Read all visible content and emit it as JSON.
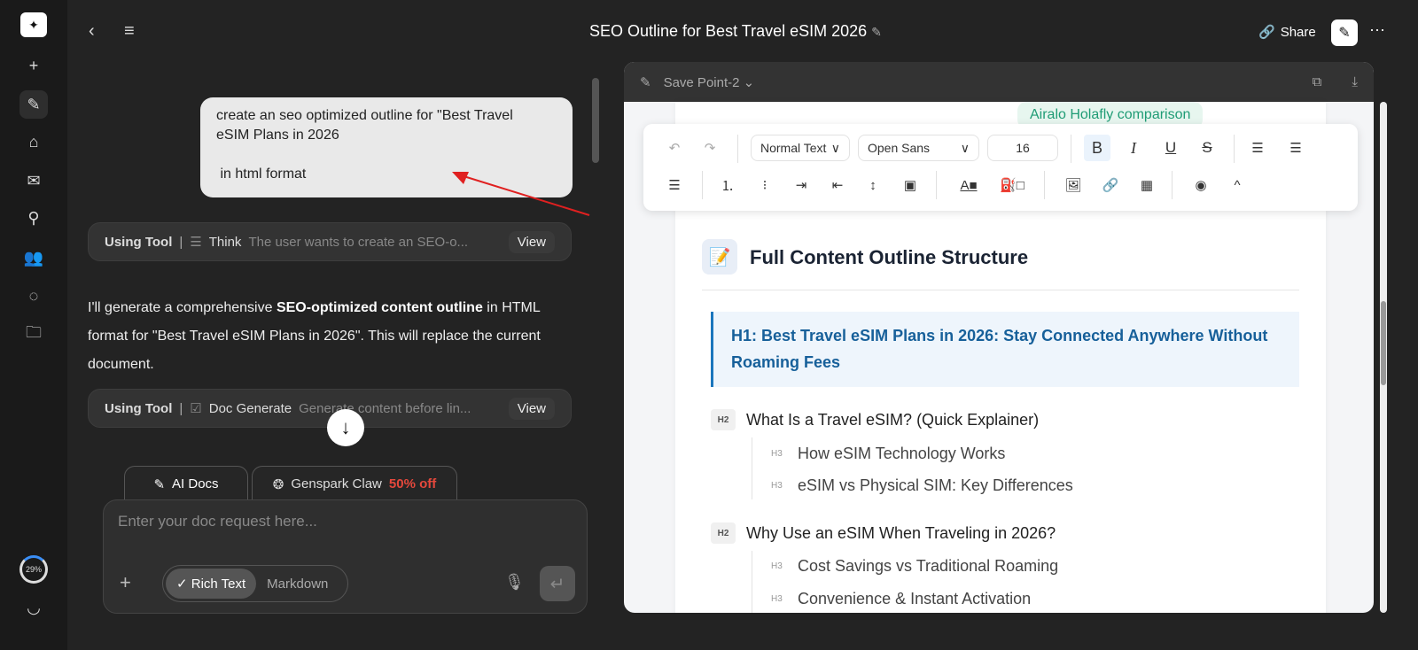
{
  "sidebar": {
    "items": [
      {
        "icon": "plus-icon",
        "glyph": "+"
      },
      {
        "icon": "ai-docs-icon",
        "glyph": "✎"
      },
      {
        "icon": "home-icon",
        "glyph": "⌂"
      },
      {
        "icon": "inbox-sparkle-icon",
        "glyph": "✉"
      },
      {
        "icon": "hierarchy-icon",
        "glyph": "⚲"
      },
      {
        "icon": "users-icon",
        "glyph": "👥"
      },
      {
        "icon": "circle-nodes-icon",
        "glyph": "◌"
      },
      {
        "icon": "folder-icon",
        "glyph": "🗀"
      }
    ],
    "usage": "29%"
  },
  "header": {
    "title": "SEO Outline for Best Travel eSIM 2026",
    "share": "Share"
  },
  "chat": {
    "user_message": "create an seo optimized outline for \"Best Travel\neSIM Plans in 2026\n\n in html format",
    "tools": [
      {
        "label": "Using Tool",
        "sep": "|",
        "name": "Think",
        "desc": "The user wants to create an SEO-o...",
        "view": "View"
      },
      {
        "label": "Using Tool",
        "sep": "|",
        "name": "Doc Generate",
        "desc": "Generate content before lin...",
        "view": "View"
      }
    ],
    "reply": {
      "pre": "I'll generate a comprehensive ",
      "bold": "SEO-optimized content outline",
      "post": " in HTML format for \"Best Travel eSIM Plans in 2026\". This will replace the current document."
    }
  },
  "composer": {
    "tabs": [
      {
        "label": "AI Docs"
      },
      {
        "label": "Genspark Claw",
        "promo": "50% off"
      }
    ],
    "placeholder": "Enter your doc request here...",
    "modes": [
      "Rich Text",
      "Markdown"
    ],
    "accent": "#e5483c"
  },
  "doc": {
    "save_point": "Save Point-2",
    "toolbar": {
      "style": "Normal Text",
      "font": "Open Sans",
      "size": "16"
    },
    "chip": "Airalo Holafly comparison",
    "section_title": "Full Content Outline Structure",
    "h1": "H1: Best Travel eSIM Plans in 2026: Stay Connected Anywhere Without Roaming Fees",
    "outline": [
      {
        "level": "H2",
        "text": "What Is a Travel eSIM? (Quick Explainer)",
        "children": [
          {
            "level": "H3",
            "text": "How eSIM Technology Works"
          },
          {
            "level": "H3",
            "text": "eSIM vs Physical SIM: Key Differences"
          }
        ]
      },
      {
        "level": "H2",
        "text": "Why Use an eSIM When Traveling in 2026?",
        "children": [
          {
            "level": "H3",
            "text": "Cost Savings vs Traditional Roaming"
          },
          {
            "level": "H3",
            "text": "Convenience & Instant Activation"
          }
        ]
      }
    ]
  }
}
